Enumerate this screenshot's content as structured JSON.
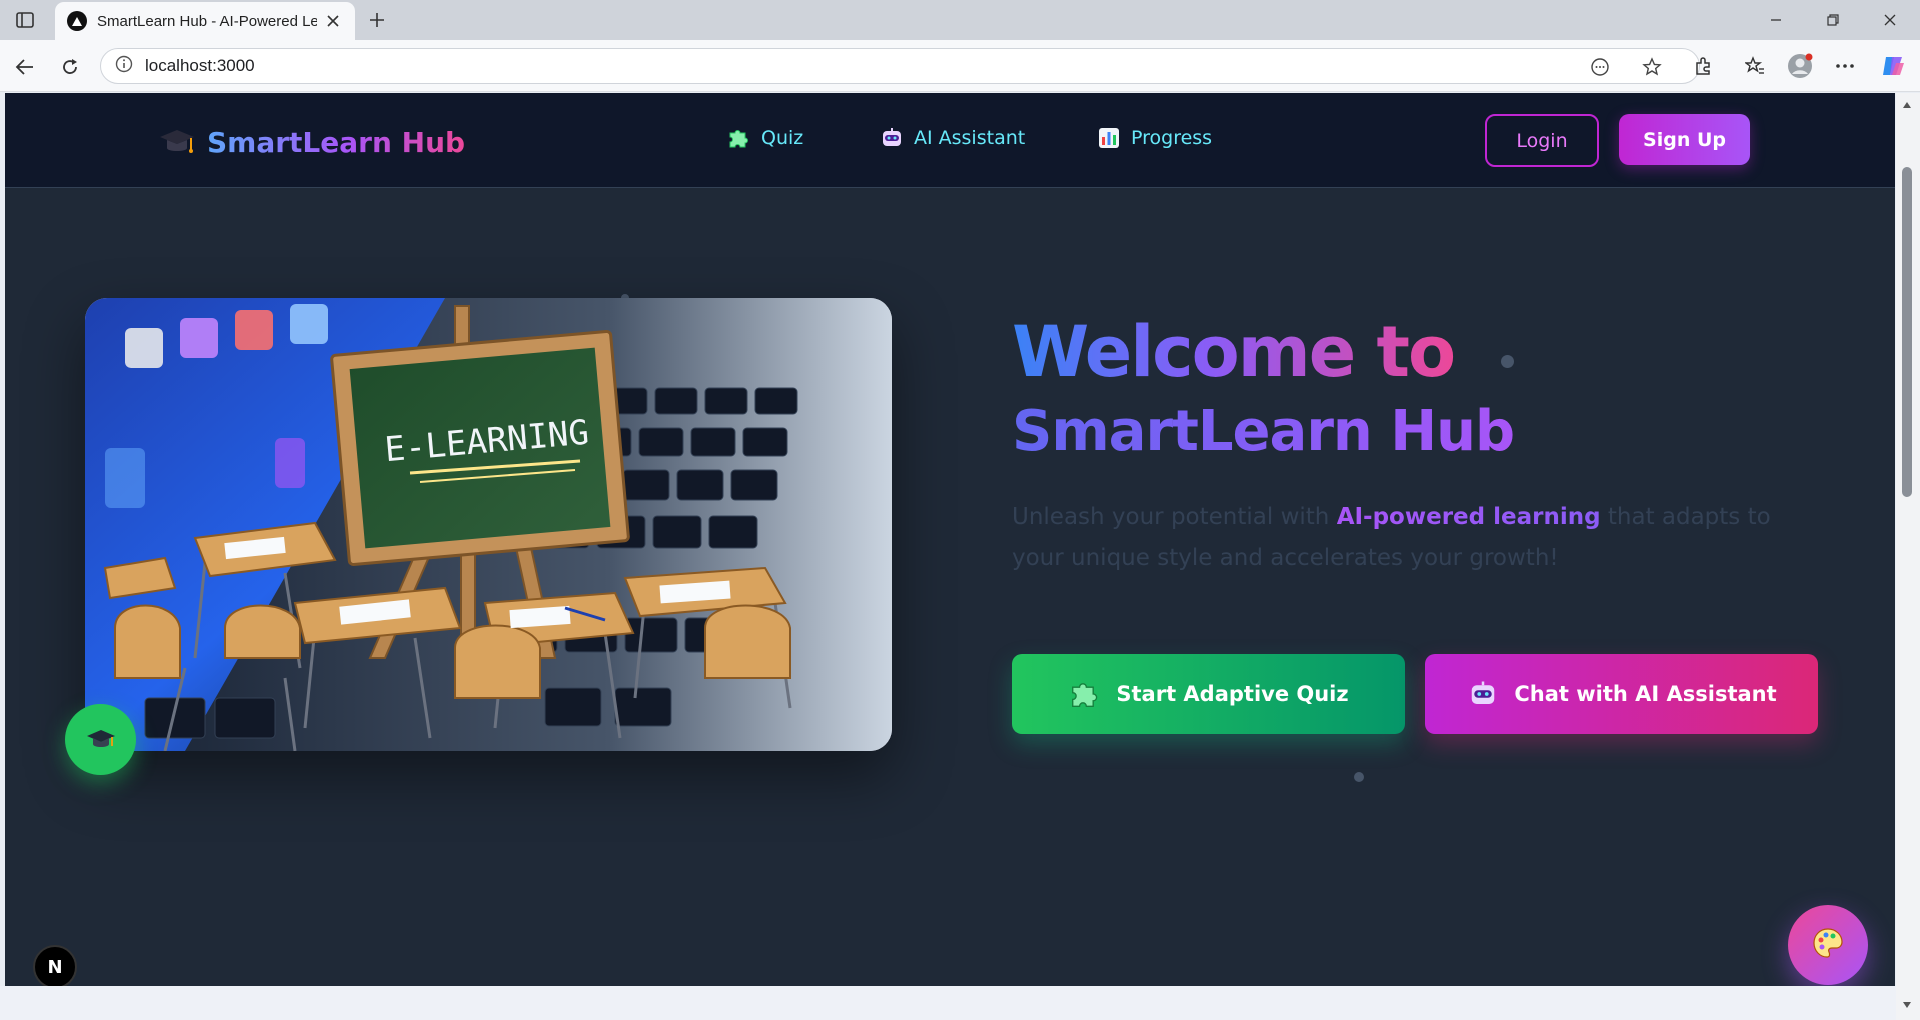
{
  "browser": {
    "tab_title": "SmartLearn Hub - AI-Powered Learning",
    "url": "localhost:3000"
  },
  "header": {
    "brand": "SmartLearn Hub",
    "nav": [
      {
        "label": "Quiz",
        "icon": "puzzle-icon"
      },
      {
        "label": "AI Assistant",
        "icon": "robot-icon"
      },
      {
        "label": "Progress",
        "icon": "bar-chart-icon"
      }
    ],
    "login_label": "Login",
    "signup_label": "Sign Up"
  },
  "hero": {
    "title_line1": "Welcome to",
    "title_line2": "SmartLearn Hub",
    "subtitle_before": "Unleash your potential with ",
    "subtitle_highlight": "AI-powered learning",
    "subtitle_after": " that adapts to your unique style and accelerates your growth!",
    "image_text": "E-LEARNING",
    "cta_quiz": "Start Adaptive Quiz",
    "cta_ai": "Chat with AI Assistant"
  },
  "dev_badge": "N",
  "colors": {
    "page_bg": "#1f2937",
    "header_bg": "#0f172a",
    "accent_cyan": "#67e8f9",
    "accent_magenta": "#c026d3",
    "accent_green": "#22c55e",
    "accent_pink": "#db2777"
  }
}
